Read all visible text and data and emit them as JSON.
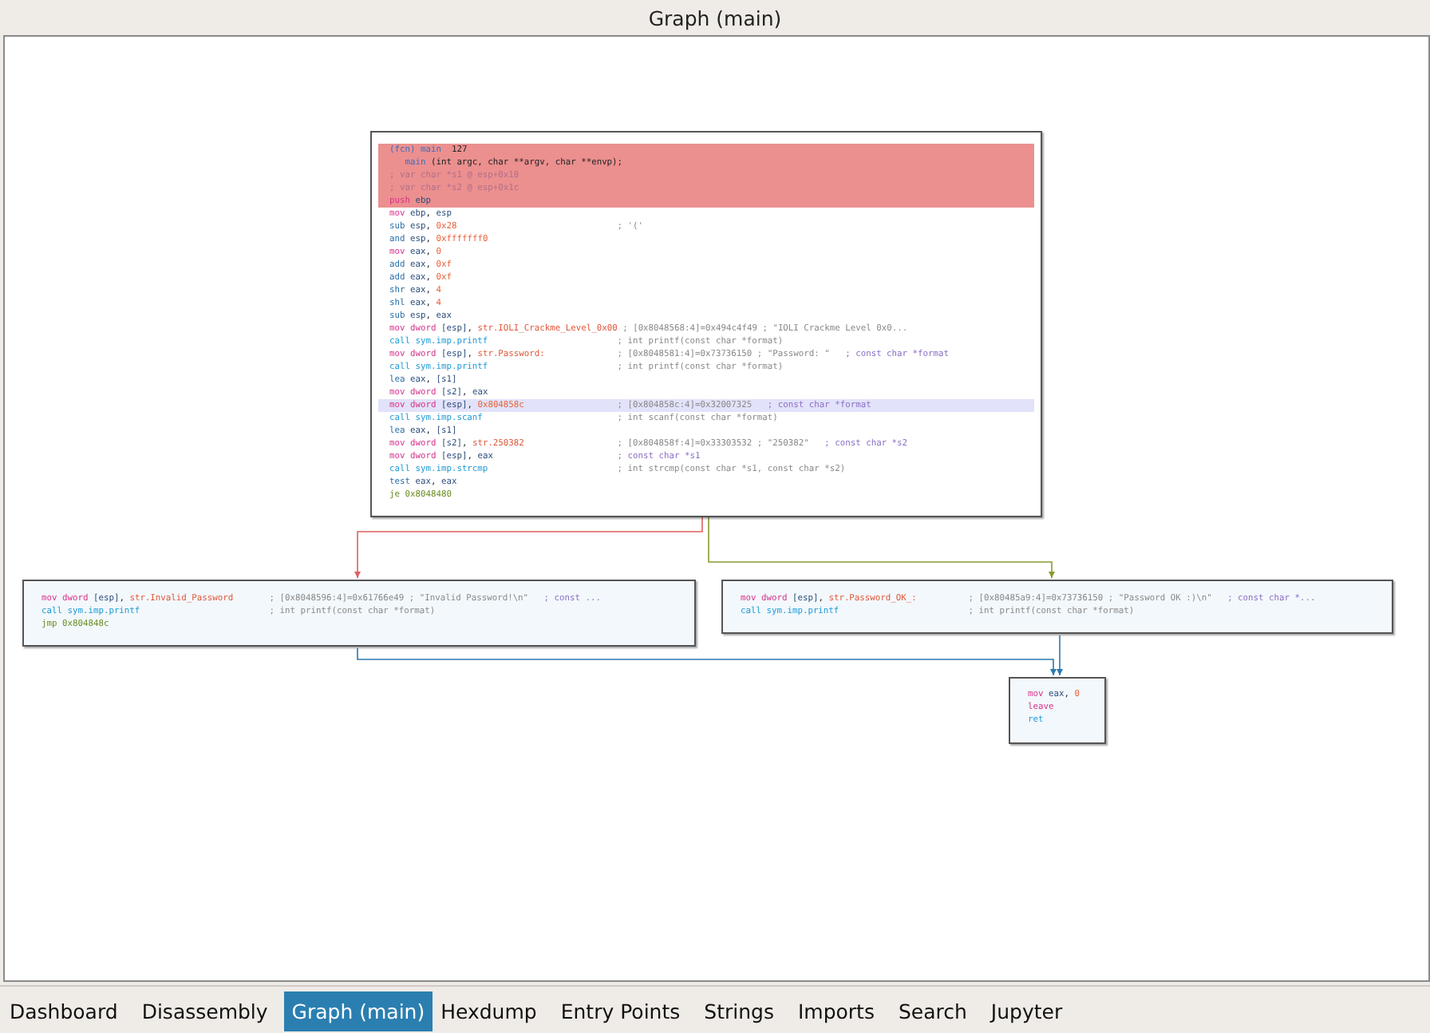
{
  "window": {
    "title": "Graph (main)"
  },
  "graph": {
    "blocks": [
      {
        "lines": [
          {
            "kind": "header",
            "selected": false,
            "code": [
              {
                "text": "(fcn) main",
                "kind": "fcn"
              },
              {
                "text": "  127",
                "kind": "plain"
              }
            ]
          },
          {
            "kind": "header",
            "selected": false,
            "code": [
              {
                "text": "   main",
                "kind": "fcn"
              },
              {
                "text": " (int argc, char **argv, char **envp);",
                "kind": "plain"
              }
            ]
          },
          {
            "kind": "header",
            "selected": false,
            "code": [
              {
                "text": "; var char *s1",
                "kind": "faint"
              },
              {
                "text": " @ esp+0x18",
                "kind": "faint"
              }
            ]
          },
          {
            "kind": "header",
            "selected": false,
            "code": [
              {
                "text": "; var char *s2",
                "kind": "faint"
              },
              {
                "text": " @ esp+0x1c",
                "kind": "faint"
              }
            ]
          },
          {
            "kind": "header",
            "selected": false,
            "code": [
              {
                "text": "push",
                "kind": "mov"
              },
              {
                "text": " ebp",
                "kind": "reg"
              }
            ]
          },
          {
            "kind": "code",
            "selected": false,
            "code": [
              {
                "text": "mov",
                "kind": "mov"
              },
              {
                "text": " ebp",
                "kind": "reg"
              },
              {
                "text": ", ",
                "kind": "plain"
              },
              {
                "text": "esp",
                "kind": "reg"
              }
            ]
          },
          {
            "kind": "code",
            "selected": false,
            "code": [
              {
                "text": "sub",
                "kind": "op"
              },
              {
                "text": " esp",
                "kind": "reg"
              },
              {
                "text": ", ",
                "kind": "plain"
              },
              {
                "text": "0x28",
                "kind": "num"
              }
            ],
            "comment": [
              {
                "text": "; '('",
                "kind": "note"
              }
            ]
          },
          {
            "kind": "code",
            "selected": false,
            "code": [
              {
                "text": "and",
                "kind": "op"
              },
              {
                "text": " esp",
                "kind": "reg"
              },
              {
                "text": ", ",
                "kind": "plain"
              },
              {
                "text": "0xfffffff0",
                "kind": "num"
              }
            ]
          },
          {
            "kind": "code",
            "selected": false,
            "code": [
              {
                "text": "mov",
                "kind": "mov"
              },
              {
                "text": " eax",
                "kind": "reg"
              },
              {
                "text": ", ",
                "kind": "plain"
              },
              {
                "text": "0",
                "kind": "num"
              }
            ]
          },
          {
            "kind": "code",
            "selected": false,
            "code": [
              {
                "text": "add",
                "kind": "op"
              },
              {
                "text": " eax",
                "kind": "reg"
              },
              {
                "text": ", ",
                "kind": "plain"
              },
              {
                "text": "0xf",
                "kind": "num"
              }
            ]
          },
          {
            "kind": "code",
            "selected": false,
            "code": [
              {
                "text": "add",
                "kind": "op"
              },
              {
                "text": " eax",
                "kind": "reg"
              },
              {
                "text": ", ",
                "kind": "plain"
              },
              {
                "text": "0xf",
                "kind": "num"
              }
            ]
          },
          {
            "kind": "code",
            "selected": false,
            "code": [
              {
                "text": "shr",
                "kind": "op"
              },
              {
                "text": " eax",
                "kind": "reg"
              },
              {
                "text": ", ",
                "kind": "plain"
              },
              {
                "text": "4",
                "kind": "num"
              }
            ]
          },
          {
            "kind": "code",
            "selected": false,
            "code": [
              {
                "text": "shl",
                "kind": "op"
              },
              {
                "text": " eax",
                "kind": "reg"
              },
              {
                "text": ", ",
                "kind": "plain"
              },
              {
                "text": "4",
                "kind": "num"
              }
            ]
          },
          {
            "kind": "code",
            "selected": false,
            "code": [
              {
                "text": "sub",
                "kind": "op"
              },
              {
                "text": " esp",
                "kind": "reg"
              },
              {
                "text": ", ",
                "kind": "plain"
              },
              {
                "text": "eax",
                "kind": "reg"
              }
            ]
          },
          {
            "kind": "code",
            "selected": false,
            "code": [
              {
                "text": "mov dword",
                "kind": "mov"
              },
              {
                "text": " [esp]",
                "kind": "reg"
              },
              {
                "text": ", ",
                "kind": "plain"
              },
              {
                "text": "str.IOLI_Crackme_Level_0x00",
                "kind": "str"
              }
            ],
            "comment": [
              {
                "text": "; [0x8048568:4]=0x494c4f49 ; \"IOLI Crackme Level 0x0...",
                "kind": "note"
              }
            ]
          },
          {
            "kind": "code",
            "selected": false,
            "code": [
              {
                "text": "call",
                "kind": "call"
              },
              {
                "text": " sym.imp.printf",
                "kind": "call"
              }
            ],
            "comment": [
              {
                "text": "; int printf(const char *format)",
                "kind": "note"
              }
            ]
          },
          {
            "kind": "code",
            "selected": false,
            "code": [
              {
                "text": "mov dword",
                "kind": "mov"
              },
              {
                "text": " [esp]",
                "kind": "reg"
              },
              {
                "text": ", ",
                "kind": "plain"
              },
              {
                "text": "str.Password:",
                "kind": "str"
              }
            ],
            "comment": [
              {
                "text": "; [0x8048581:4]=0x73736150 ; \"Password: \"",
                "kind": "note"
              },
              {
                "text": "; const char *format",
                "kind": "type"
              }
            ]
          },
          {
            "kind": "code",
            "selected": false,
            "code": [
              {
                "text": "call",
                "kind": "call"
              },
              {
                "text": " sym.imp.printf",
                "kind": "call"
              }
            ],
            "comment": [
              {
                "text": "; int printf(const char *format)",
                "kind": "note"
              }
            ]
          },
          {
            "kind": "code",
            "selected": false,
            "code": [
              {
                "text": "lea",
                "kind": "op"
              },
              {
                "text": " eax",
                "kind": "reg"
              },
              {
                "text": ", ",
                "kind": "plain"
              },
              {
                "text": "[s1]",
                "kind": "reg"
              }
            ]
          },
          {
            "kind": "code",
            "selected": false,
            "code": [
              {
                "text": "mov dword",
                "kind": "mov"
              },
              {
                "text": " [s2]",
                "kind": "reg"
              },
              {
                "text": ", ",
                "kind": "plain"
              },
              {
                "text": "eax",
                "kind": "reg"
              }
            ]
          },
          {
            "kind": "code",
            "selected": true,
            "code": [
              {
                "text": "mov dword",
                "kind": "mov"
              },
              {
                "text": " [esp]",
                "kind": "reg"
              },
              {
                "text": ", ",
                "kind": "plain"
              },
              {
                "text": "0x804858c",
                "kind": "num"
              }
            ],
            "comment": [
              {
                "text": "; [0x804858c:4]=0x32007325",
                "kind": "note"
              },
              {
                "text": "; const char *format",
                "kind": "type"
              }
            ]
          },
          {
            "kind": "code",
            "selected": false,
            "code": [
              {
                "text": "call",
                "kind": "call"
              },
              {
                "text": " sym.imp.scanf",
                "kind": "call"
              }
            ],
            "comment": [
              {
                "text": "; int scanf(const char *format)",
                "kind": "note"
              }
            ]
          },
          {
            "kind": "code",
            "selected": false,
            "code": [
              {
                "text": "lea",
                "kind": "op"
              },
              {
                "text": " eax",
                "kind": "reg"
              },
              {
                "text": ", ",
                "kind": "plain"
              },
              {
                "text": "[s1]",
                "kind": "reg"
              }
            ]
          },
          {
            "kind": "code",
            "selected": false,
            "code": [
              {
                "text": "mov dword",
                "kind": "mov"
              },
              {
                "text": " [s2]",
                "kind": "reg"
              },
              {
                "text": ", ",
                "kind": "plain"
              },
              {
                "text": "str.250382",
                "kind": "str"
              }
            ],
            "comment": [
              {
                "text": "; [0x804858f:4]=0x33303532 ; \"250382\"",
                "kind": "note"
              },
              {
                "text": "; const char *s2",
                "kind": "type"
              }
            ]
          },
          {
            "kind": "code",
            "selected": false,
            "code": [
              {
                "text": "mov dword",
                "kind": "mov"
              },
              {
                "text": " [esp]",
                "kind": "reg"
              },
              {
                "text": ", ",
                "kind": "plain"
              },
              {
                "text": "eax",
                "kind": "reg"
              }
            ],
            "comment": [
              {
                "text": "; const char *s1",
                "kind": "type"
              }
            ]
          },
          {
            "kind": "code",
            "selected": false,
            "code": [
              {
                "text": "call",
                "kind": "call"
              },
              {
                "text": " sym.imp.strcmp",
                "kind": "call"
              }
            ],
            "comment": [
              {
                "text": "; int strcmp(const char *s1, const char *s2)",
                "kind": "note"
              }
            ]
          },
          {
            "kind": "code",
            "selected": false,
            "code": [
              {
                "text": "test",
                "kind": "op"
              },
              {
                "text": " eax",
                "kind": "reg"
              },
              {
                "text": ", ",
                "kind": "plain"
              },
              {
                "text": "eax",
                "kind": "reg"
              }
            ]
          },
          {
            "kind": "code",
            "selected": false,
            "code": [
              {
                "text": "je",
                "kind": "jump"
              },
              {
                "text": " 0x8048480",
                "kind": "jump"
              }
            ]
          }
        ]
      },
      {
        "lines": [
          {
            "kind": "code",
            "selected": false,
            "code": [
              {
                "text": "mov dword",
                "kind": "mov"
              },
              {
                "text": " [esp]",
                "kind": "reg"
              },
              {
                "text": ", ",
                "kind": "plain"
              },
              {
                "text": "str.Invalid_Password",
                "kind": "str"
              }
            ],
            "comment": [
              {
                "text": "; [0x8048596:4]=0x61766e49 ; \"Invalid Password!\\n\"",
                "kind": "note"
              },
              {
                "text": "; const ...",
                "kind": "type"
              }
            ]
          },
          {
            "kind": "code",
            "selected": false,
            "code": [
              {
                "text": "call",
                "kind": "call"
              },
              {
                "text": " sym.imp.printf",
                "kind": "call"
              }
            ],
            "comment": [
              {
                "text": "; int printf(const char *format)",
                "kind": "note"
              }
            ]
          },
          {
            "kind": "code",
            "selected": false,
            "code": [
              {
                "text": "jmp",
                "kind": "jump"
              },
              {
                "text": " 0x804848c",
                "kind": "jump"
              }
            ]
          }
        ]
      },
      {
        "lines": [
          {
            "kind": "code",
            "selected": false,
            "code": [
              {
                "text": "mov dword",
                "kind": "mov"
              },
              {
                "text": " [esp]",
                "kind": "reg"
              },
              {
                "text": ", ",
                "kind": "plain"
              },
              {
                "text": "str.Password_OK_:",
                "kind": "str"
              }
            ],
            "comment": [
              {
                "text": "; [0x80485a9:4]=0x73736150 ; \"Password OK :)\\n\"",
                "kind": "note"
              },
              {
                "text": "; const char *...",
                "kind": "type"
              }
            ]
          },
          {
            "kind": "code",
            "selected": false,
            "code": [
              {
                "text": "call",
                "kind": "call"
              },
              {
                "text": " sym.imp.printf",
                "kind": "call"
              }
            ],
            "comment": [
              {
                "text": "; int printf(const char *format)",
                "kind": "note"
              }
            ]
          }
        ]
      },
      {
        "lines": [
          {
            "kind": "code",
            "selected": false,
            "code": [
              {
                "text": "mov",
                "kind": "mov"
              },
              {
                "text": " eax",
                "kind": "reg"
              },
              {
                "text": ", ",
                "kind": "plain"
              },
              {
                "text": "0",
                "kind": "num"
              }
            ]
          },
          {
            "kind": "code",
            "selected": false,
            "code": [
              {
                "text": "leave",
                "kind": "mov"
              }
            ]
          },
          {
            "kind": "code",
            "selected": false,
            "code": [
              {
                "text": "ret",
                "kind": "call"
              }
            ]
          }
        ]
      }
    ],
    "edges": [
      {
        "kind": "false"
      },
      {
        "kind": "true"
      },
      {
        "kind": "jump"
      },
      {
        "kind": "jump"
      }
    ]
  },
  "tabs": [
    {
      "label": "Dashboard",
      "selected": false
    },
    {
      "label": "Disassembly",
      "selected": false
    },
    {
      "label": "Graph (main)",
      "selected": true
    },
    {
      "label": "Hexdump",
      "selected": false
    },
    {
      "label": "Entry Points",
      "selected": false
    },
    {
      "label": "Strings",
      "selected": false
    },
    {
      "label": "Imports",
      "selected": false
    },
    {
      "label": "Search",
      "selected": false
    },
    {
      "label": "Jupyter",
      "selected": false
    }
  ]
}
